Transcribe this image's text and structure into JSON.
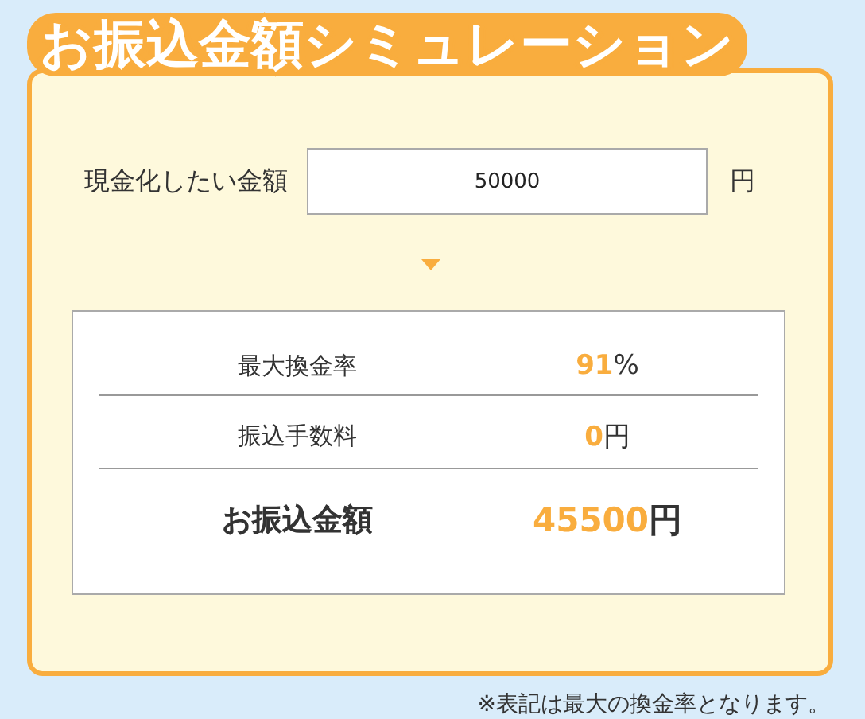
{
  "title": "お振込金額シミュレーション",
  "input": {
    "label": "現金化したい金額",
    "value": "50000",
    "unit": "円"
  },
  "results": [
    {
      "kind": "normal",
      "label": "最大換金率",
      "value": "91",
      "unit": "%"
    },
    {
      "kind": "normal",
      "label": "振込手数料",
      "value": "0",
      "unit": "円"
    },
    {
      "kind": "total",
      "label": "お振込金額",
      "value": "45500",
      "unit": "円"
    }
  ],
  "note": "※表記は最大の換金率となります。"
}
